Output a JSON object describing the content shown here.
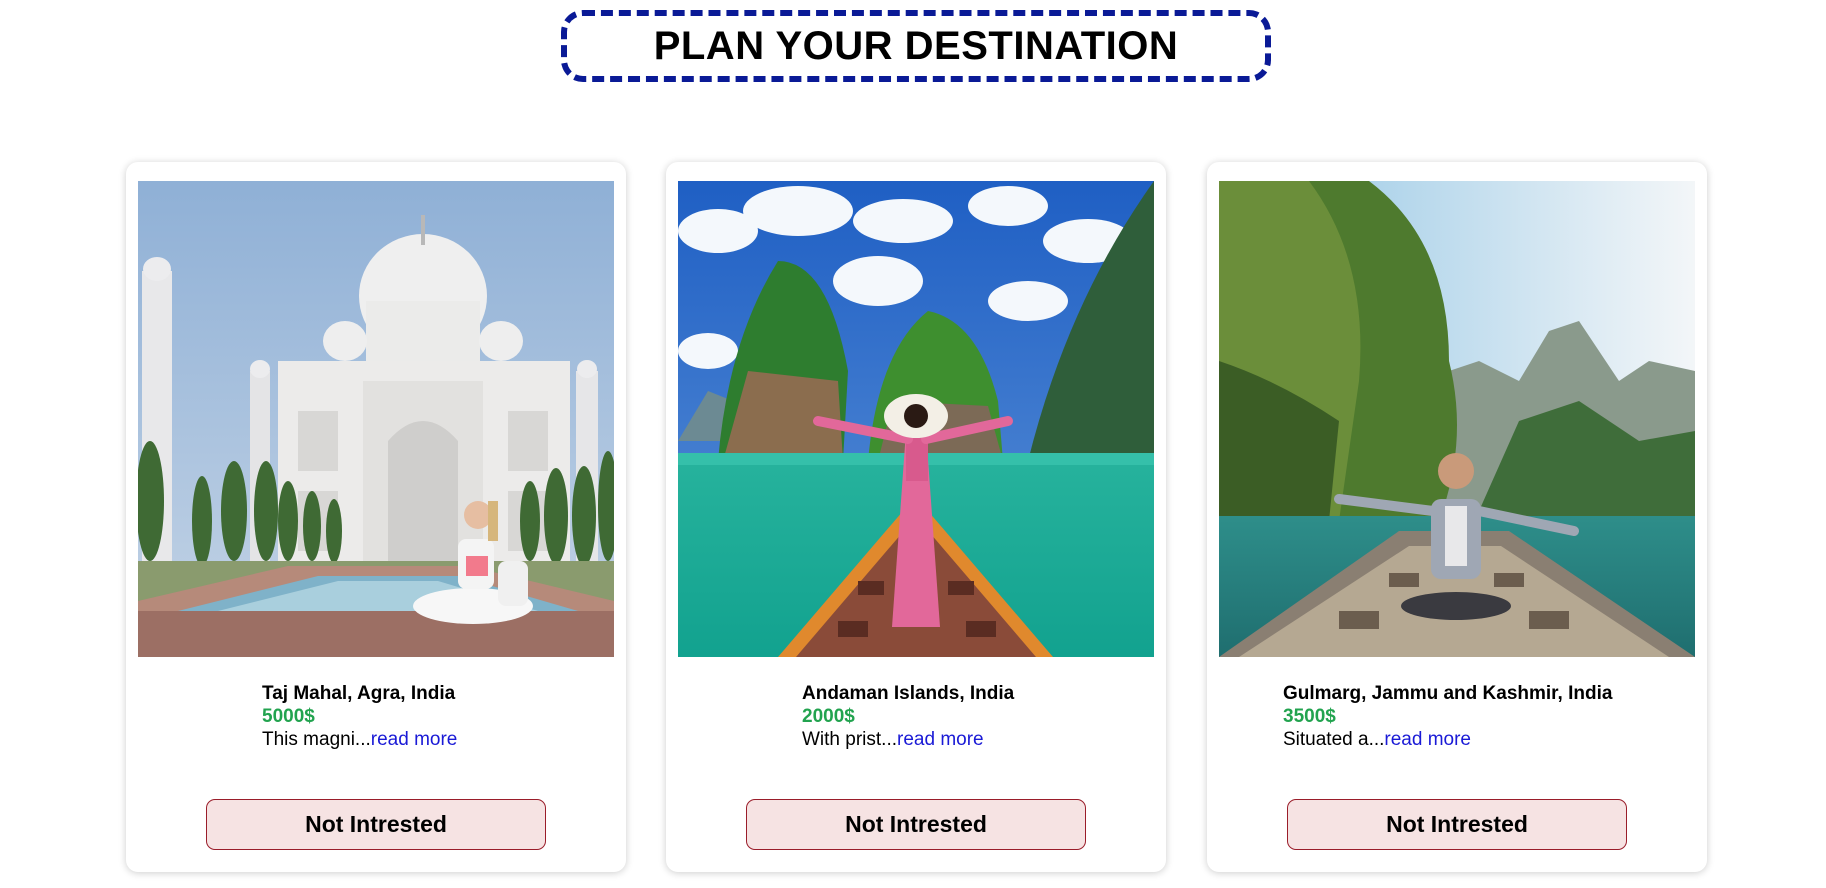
{
  "header": {
    "title": "PLAN YOUR DESTINATION"
  },
  "colors": {
    "title_border": "#0a1a96",
    "price": "#22a34f",
    "link": "#1a1ad6",
    "button_bg": "#f6e3e3",
    "button_border": "#9a1d2a"
  },
  "cards": [
    {
      "place": "Taj Mahal, Agra, India",
      "price": "5000$",
      "description": "This magni...",
      "read_more": "read more",
      "button": "Not Intrested"
    },
    {
      "place": "Andaman Islands, India",
      "price": "2000$",
      "description": "With prist...",
      "read_more": "read more",
      "button": "Not Intrested"
    },
    {
      "place": "Gulmarg, Jammu and Kashmir, India",
      "price": "3500$",
      "description": "Situated a...",
      "read_more": "read more",
      "button": "Not Intrested"
    }
  ]
}
